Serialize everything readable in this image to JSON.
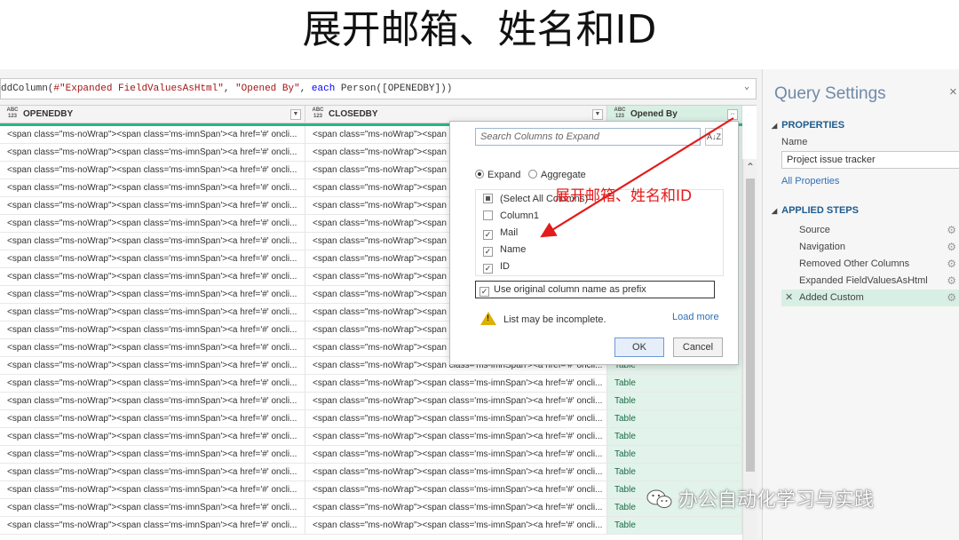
{
  "slide_title": "展开邮箱、姓名和ID",
  "formula_bar": {
    "prefix": "ddColumn(",
    "arg1": "#\"Expanded FieldValuesAsHtml\"",
    "sep1": ", ",
    "arg2": "\"Opened By\"",
    "sep2": ", ",
    "kw": "each",
    "rest": " Person([OPENEDBY]))"
  },
  "columns": [
    {
      "type": "ABC\n123",
      "type_top": "ABC",
      "type_bottom": "123",
      "name": "OPENEDBY"
    },
    {
      "type_top": "ABC",
      "type_bottom": "123",
      "name": "CLOSEDBY"
    },
    {
      "type_top": "ABC",
      "type_bottom": "123",
      "name": "Opened By"
    }
  ],
  "cell_text": {
    "c1": "<span class=\"ms-noWrap\"><span class='ms-imnSpan'><a href='#' oncli...",
    "c2_full": "<span class=\"ms-noWrap\"><span class='ms-imnSpan'><a href='#' oncli...",
    "c2_short": "<span class=\"ms-noWrap\"><span",
    "c3": "Table"
  },
  "expand_dialog": {
    "search_placeholder": "Search Columns to Expand",
    "sort_label": "A↓Z",
    "radio_expand": "Expand",
    "radio_aggregate": "Aggregate",
    "items": [
      {
        "label": "(Select All Columns)",
        "state": "partial"
      },
      {
        "label": "Column1",
        "state": "unchecked"
      },
      {
        "label": "Mail",
        "state": "checked"
      },
      {
        "label": "Name",
        "state": "checked"
      },
      {
        "label": "ID",
        "state": "checked"
      }
    ],
    "prefix_label": "Use original column name as prefix",
    "warning": "List may be incomplete.",
    "load_more": "Load more",
    "ok": "OK",
    "cancel": "Cancel"
  },
  "annotation": "展开邮箱、姓名和ID",
  "query_settings": {
    "title": "Query Settings",
    "close": "×",
    "properties_label": "PROPERTIES",
    "name_label": "Name",
    "name_value": "Project issue tracker",
    "all_properties": "All Properties",
    "applied_steps_label": "APPLIED STEPS",
    "steps": [
      "Source",
      "Navigation",
      "Removed Other Columns",
      "Expanded FieldValuesAsHtml",
      "Added Custom"
    ]
  },
  "watermark": "办公自动化学习与实践",
  "colors": {
    "accent_green": "#2fb389",
    "selected_bg": "#d8efe3",
    "annotation_red": "#e31b1b",
    "link_blue": "#2f6fb7"
  }
}
